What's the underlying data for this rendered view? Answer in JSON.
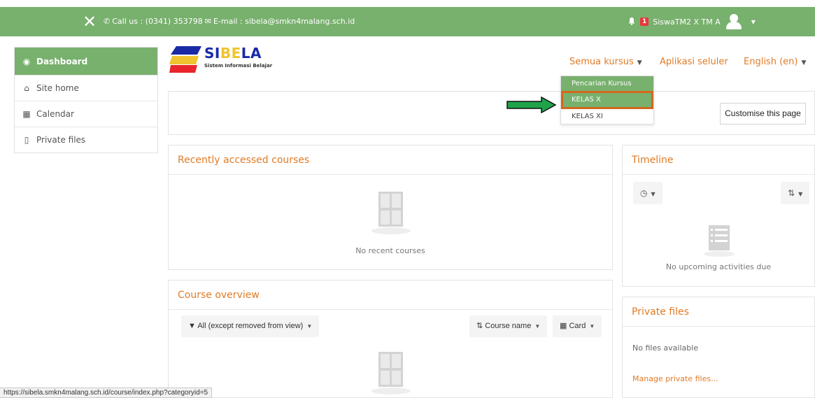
{
  "topbar": {
    "close_glyph": "✕",
    "phone_icon": "phone-icon",
    "contact_phone": "Call us : (0341) 353798",
    "mail_icon": "envelope-icon",
    "contact_email": "E-mail : sibela@smkn4malang.sch.id",
    "badge_count": "1",
    "username": "SiswaTM2 X TM A",
    "bar_color": "#78b06d"
  },
  "sidebar": {
    "items": [
      {
        "label": "Dashboard",
        "icon": "tachometer-icon",
        "active": true
      },
      {
        "label": "Site home",
        "icon": "home-icon"
      },
      {
        "label": "Calendar",
        "icon": "calendar-icon"
      },
      {
        "label": "Private files",
        "icon": "file-icon"
      }
    ]
  },
  "logo": {
    "brand_a": "SI",
    "brand_b": "BE",
    "brand_c": "LA",
    "tagline": "Sistem Informasi Belajar"
  },
  "nav": {
    "courses": "Semua kursus",
    "mobile_app": "Aplikasi seluler",
    "language": "English (en)"
  },
  "dropdown": {
    "items": [
      "Pencarian Kursus",
      "KELAS X",
      "KELAS XI"
    ]
  },
  "main": {
    "customise_label": "Customise this page",
    "recent": {
      "title": "Recently accessed courses",
      "empty": "No recent courses"
    },
    "overview": {
      "title": "Course overview",
      "filter": "All (except removed from view)",
      "sort": "Course name",
      "view": "Card"
    }
  },
  "timeline": {
    "title": "Timeline",
    "empty": "No upcoming activities due"
  },
  "private_files": {
    "title": "Private files",
    "empty": "No files available",
    "manage": "Manage private files..."
  },
  "status_url": "https://sibela.smkn4malang.sch.id/course/index.php?categoryid=5",
  "colors": {
    "accent": "#e07b26",
    "green": "#78b06d",
    "highlight_outline": "#d2691e"
  }
}
